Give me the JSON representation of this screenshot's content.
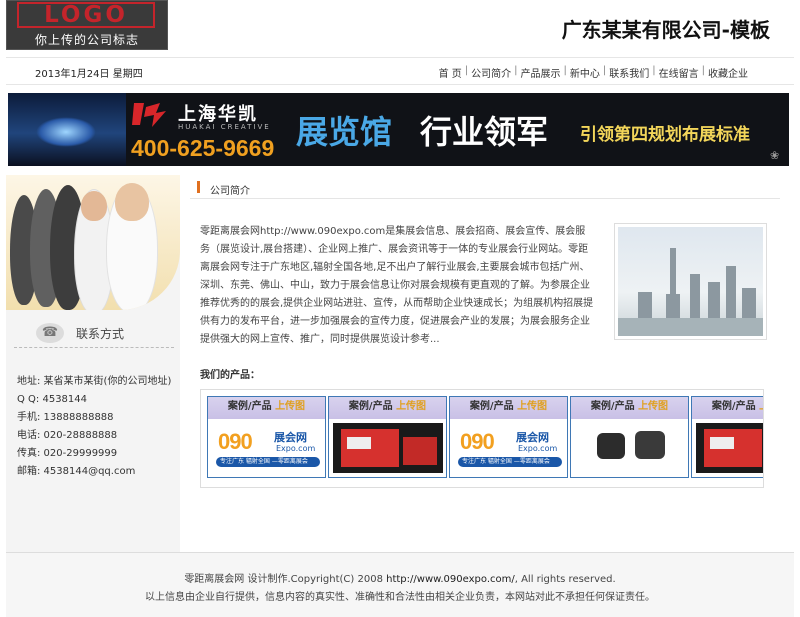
{
  "header": {
    "logo_text": "LOGO",
    "logo_sub": "你上传的公司标志",
    "company_title": "广东某某有限公司-模板"
  },
  "topbar": {
    "date": "2013年1月24日 星期四",
    "nav": [
      "首 页",
      "公司简介",
      "产品展示",
      "新中心",
      "联系我们",
      "在线留言",
      "收藏企业"
    ]
  },
  "banner": {
    "brand_cn": "上海华凯",
    "brand_en": "HUAKAI CREATIVE",
    "phone": "400-625-9669",
    "headline_a": "展览馆",
    "headline_b": "行业领军",
    "tagline": "引领第四规划布展标准"
  },
  "sidebar": {
    "contact_title": "联系方式",
    "contacts": [
      "地址: 某省某市某街(你的公司地址)",
      "Q Q: 4538144",
      "手机: 13888888888",
      "电话: 020-28888888",
      "传真: 020-29999999",
      "邮箱: 4538144@qq.com"
    ]
  },
  "main": {
    "section_title": "公司简介",
    "intro": "零距离展会网http://www.090expo.com是集展会信息、展会招商、展会宣传、展会服务（展览设计,展台搭建）、企业网上推广、展会资讯等于一体的专业展会行业网站。零距离展会网专注于广东地区,辐射全国各地,足不出户了解行业展会,主要展会城市包括广州、深圳、东莞、佛山、中山，致力于展会信息让你对展会规模有更直观的了解。为参展企业推荐优秀的的展会,提供企业网站进驻、宣传，从而帮助企业快速成长；为组展机构招展提供有力的发布平台，进一步加强展会的宣传力度，促进展会产业的发展；为展会服务企业提供强大的网上宣传、推广，同时提供展览设计参考...",
    "products_title": "我们的产品：",
    "products": [
      {
        "label": "案例/产品",
        "highlight": "上传图",
        "kind": "090"
      },
      {
        "label": "案例/产品",
        "highlight": "上传图",
        "kind": "booth"
      },
      {
        "label": "案例/产品",
        "highlight": "上传图",
        "kind": "090"
      },
      {
        "label": "案例/产品",
        "highlight": "上传图",
        "kind": "motor"
      },
      {
        "label": "案例/产品",
        "highlight": "上传图",
        "kind": "booth"
      }
    ],
    "logo090": {
      "num": "090",
      "cn": "展会网",
      "en": "Expo.com",
      "slogan": "专注广东 辐射全国 —零距离展会"
    }
  },
  "footer": {
    "line1_prefix": "零距离展会网 设计制作.Copyright(C) 2008 ",
    "line1_link": "http://www.090expo.com/",
    "line1_suffix": ", All rights reserved.",
    "line2": "以上信息由企业自行提供，信息内容的真实性、准确性和合法性由相关企业负责，本网站对此不承担任何保证责任。"
  },
  "colors": {
    "accent": "#e07020",
    "logo_red": "#c4242b",
    "product_frame": "#3f78b5"
  }
}
